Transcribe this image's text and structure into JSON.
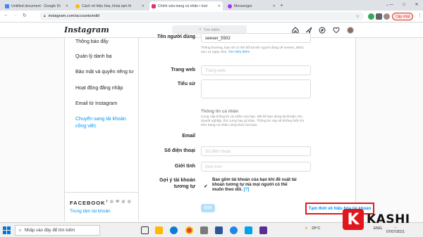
{
  "browser": {
    "tabs": [
      {
        "title": "Untitled document - Google Do",
        "fav_color": "#4285f4",
        "active": false
      },
      {
        "title": "Cách vô hiệu hóa, khóa tạm thời",
        "fav_color": "#fbbc04",
        "active": false
      },
      {
        "title": "Chỉnh sửa trang cá nhân • Instagr",
        "fav_color": "#e1306c",
        "active": true
      },
      {
        "title": "Messenger",
        "fav_color": "#a033ff",
        "active": false
      }
    ],
    "new_tab": "+",
    "url": "instagram.com/accounts/edit/",
    "update_label": "Cập nhật",
    "window_controls": [
      "—",
      "□",
      "✕"
    ]
  },
  "instagram": {
    "logo": "Instagram",
    "search_placeholder": "Tìm kiếm",
    "nav_icons": [
      "home-icon",
      "messenger-icon",
      "new-post-icon",
      "explore-icon",
      "heart-icon"
    ],
    "sidebar": {
      "items": [
        {
          "label": "Thông báo đẩy",
          "active": false
        },
        {
          "label": "Quản lý danh bạ",
          "active": false
        },
        {
          "label": "Bảo mật và quyền riêng tư",
          "active": false
        },
        {
          "label": "Hoạt động đăng nhập",
          "active": false
        },
        {
          "label": "Email từ Instagram",
          "active": false
        },
        {
          "label": "Chuyển sang tài khoản công việc",
          "active": true
        }
      ],
      "facebook_logo": "FACEBOOK",
      "facebook_icons": "f ◎ ✉ ◎ ◎",
      "accounts_center": "Trung tâm tài khoản"
    },
    "form": {
      "username_label": "Tên người dùng",
      "username_value": "seeser_5502",
      "username_help": "Thông thường, bạn sẽ có thể đổi lại tên người dùng về seeser_5502 sau 14 ngày nữa.",
      "username_help_link": "Tìm hiểu thêm",
      "website_label": "Trang web",
      "website_placeholder": "Trang web",
      "bio_label": "Tiểu sử",
      "personal_info_title": "Thông tin cá nhân",
      "personal_info_help": "Cung cấp thông tin cá nhân của bạn, bất kể bạn dùng tài khoản cho doanh nghiệp, thú cưng hay gì khác. Thông tin này sẽ không hiển thị trên trang cá nhân công khai của bạn.",
      "email_label": "Email",
      "phone_label": "Số điện thoại",
      "phone_placeholder": "Số điện thoại",
      "gender_label": "Giới tính",
      "gender_placeholder": "Giới tính",
      "suggest_label": "Gợi ý tài khoản tương tự",
      "suggest_text": "Bao gồm tài khoản của bạn khi đề xuất tài khoản tương tự mà mọi người có thể muốn theo dõi.",
      "suggest_help": "[?]",
      "suggest_checked": true,
      "submit_label": "Gửi",
      "deactivate_label": "Tạm thời vô hiệu hóa tài khoản"
    }
  },
  "taskbar": {
    "search_placeholder": "Nhập vào đây để tìm kiếm",
    "weather": "29°C",
    "language": "ENG",
    "time": "...",
    "date": "07/07/2021"
  },
  "watermark": {
    "logo_letter": "K",
    "text": "KASHI"
  }
}
